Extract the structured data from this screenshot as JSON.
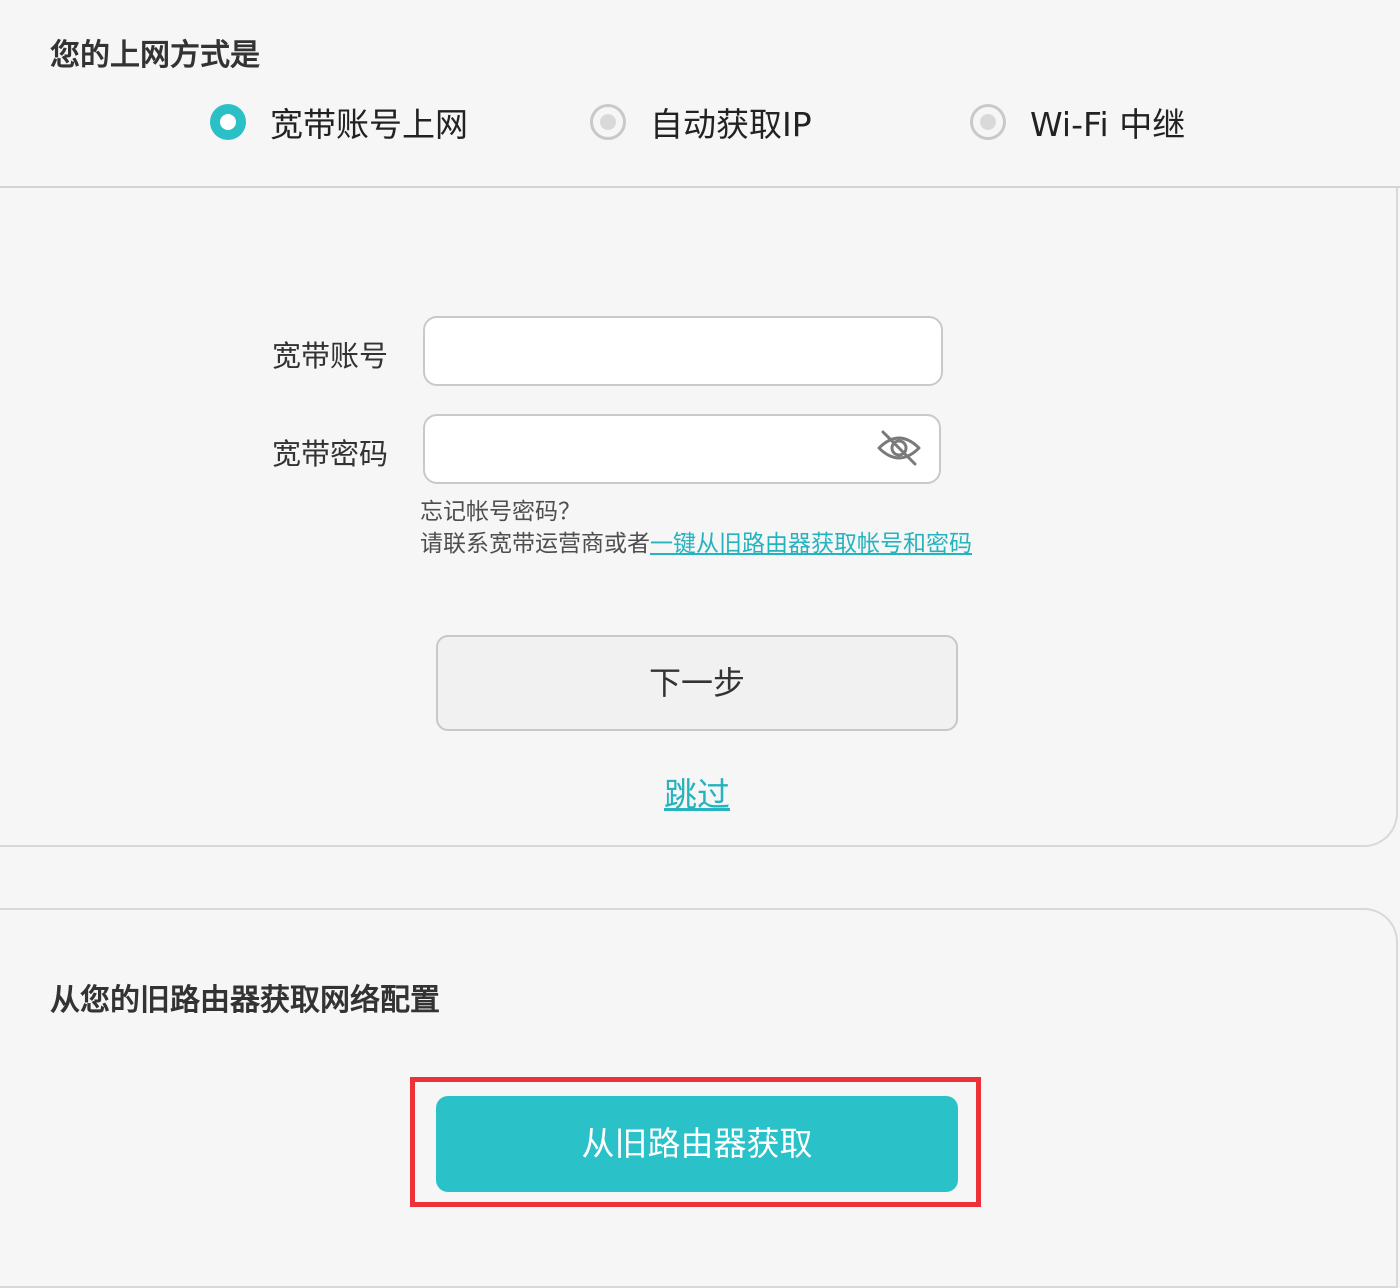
{
  "connection": {
    "title": "您的上网方式是",
    "options": [
      {
        "label": "宽带账号上网",
        "checked": true
      },
      {
        "label": "自动获取IP",
        "checked": false
      },
      {
        "label": "Wi-Fi 中继",
        "checked": false
      }
    ]
  },
  "form": {
    "account_label": "宽带账号",
    "account_value": "",
    "password_label": "宽带密码",
    "password_value": "",
    "password_toggle_icon": "eye-hidden-icon",
    "forgot_line": "忘记帐号密码？",
    "contact_text": "请联系宽带运营商或者",
    "one_click_link": "一键从旧路由器获取帐号和密码",
    "next_button": "下一步",
    "skip_link": "跳过"
  },
  "old_router": {
    "title": "从您的旧路由器获取网络配置",
    "button": "从旧路由器获取"
  },
  "colors": {
    "accent": "#2bc1c8",
    "link": "#25b3be",
    "highlight": "#ec3237"
  }
}
